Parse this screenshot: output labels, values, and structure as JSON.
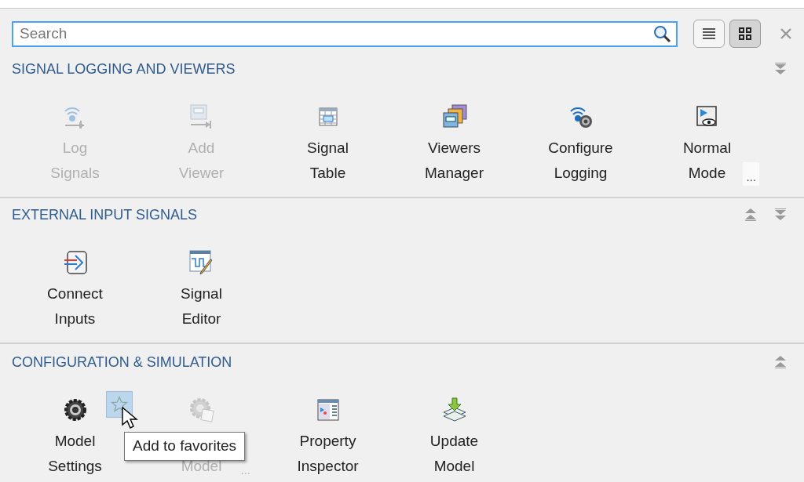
{
  "search": {
    "placeholder": "Search"
  },
  "view_buttons": [
    {
      "kind": "list",
      "selected": false
    },
    {
      "kind": "grid",
      "selected": true
    }
  ],
  "sections": [
    {
      "title": "SIGNAL LOGGING AND VIEWERS",
      "arrows": [
        {
          "kind": "expand"
        }
      ],
      "items": [
        {
          "lines": [
            "Log",
            "Signals"
          ],
          "disabled": true
        },
        {
          "lines": [
            "Add",
            "Viewer"
          ],
          "disabled": true
        },
        {
          "lines": [
            "Signal",
            "Table"
          ],
          "disabled": false
        },
        {
          "lines": [
            "Viewers",
            "Manager"
          ],
          "disabled": false
        },
        {
          "lines": [
            "Configure",
            "Logging"
          ],
          "disabled": false
        },
        {
          "lines": [
            "Normal",
            "Mode"
          ],
          "disabled": false,
          "more": "..."
        }
      ]
    },
    {
      "title": "EXTERNAL INPUT SIGNALS",
      "arrows": [
        {
          "kind": "collapse"
        },
        {
          "kind": "expand"
        }
      ],
      "items": [
        {
          "lines": [
            "Connect",
            "Inputs"
          ],
          "disabled": false
        },
        {
          "lines": [
            "Signal",
            "Editor"
          ],
          "disabled": false
        }
      ]
    },
    {
      "title": "CONFIGURATION & SIMULATION",
      "arrows": [
        {
          "kind": "collapse"
        }
      ],
      "items": [
        {
          "lines": [
            "Model",
            "Settings"
          ],
          "disabled": false,
          "hovered": true
        },
        {
          "lines": [
            "Model"
          ],
          "disabled": true,
          "more": "..."
        },
        {
          "lines": [
            "Property",
            "Inspector"
          ],
          "disabled": false
        },
        {
          "lines": [
            "Update",
            "Model"
          ],
          "disabled": false
        }
      ]
    }
  ],
  "tooltip": {
    "text": "Add to favorites"
  }
}
